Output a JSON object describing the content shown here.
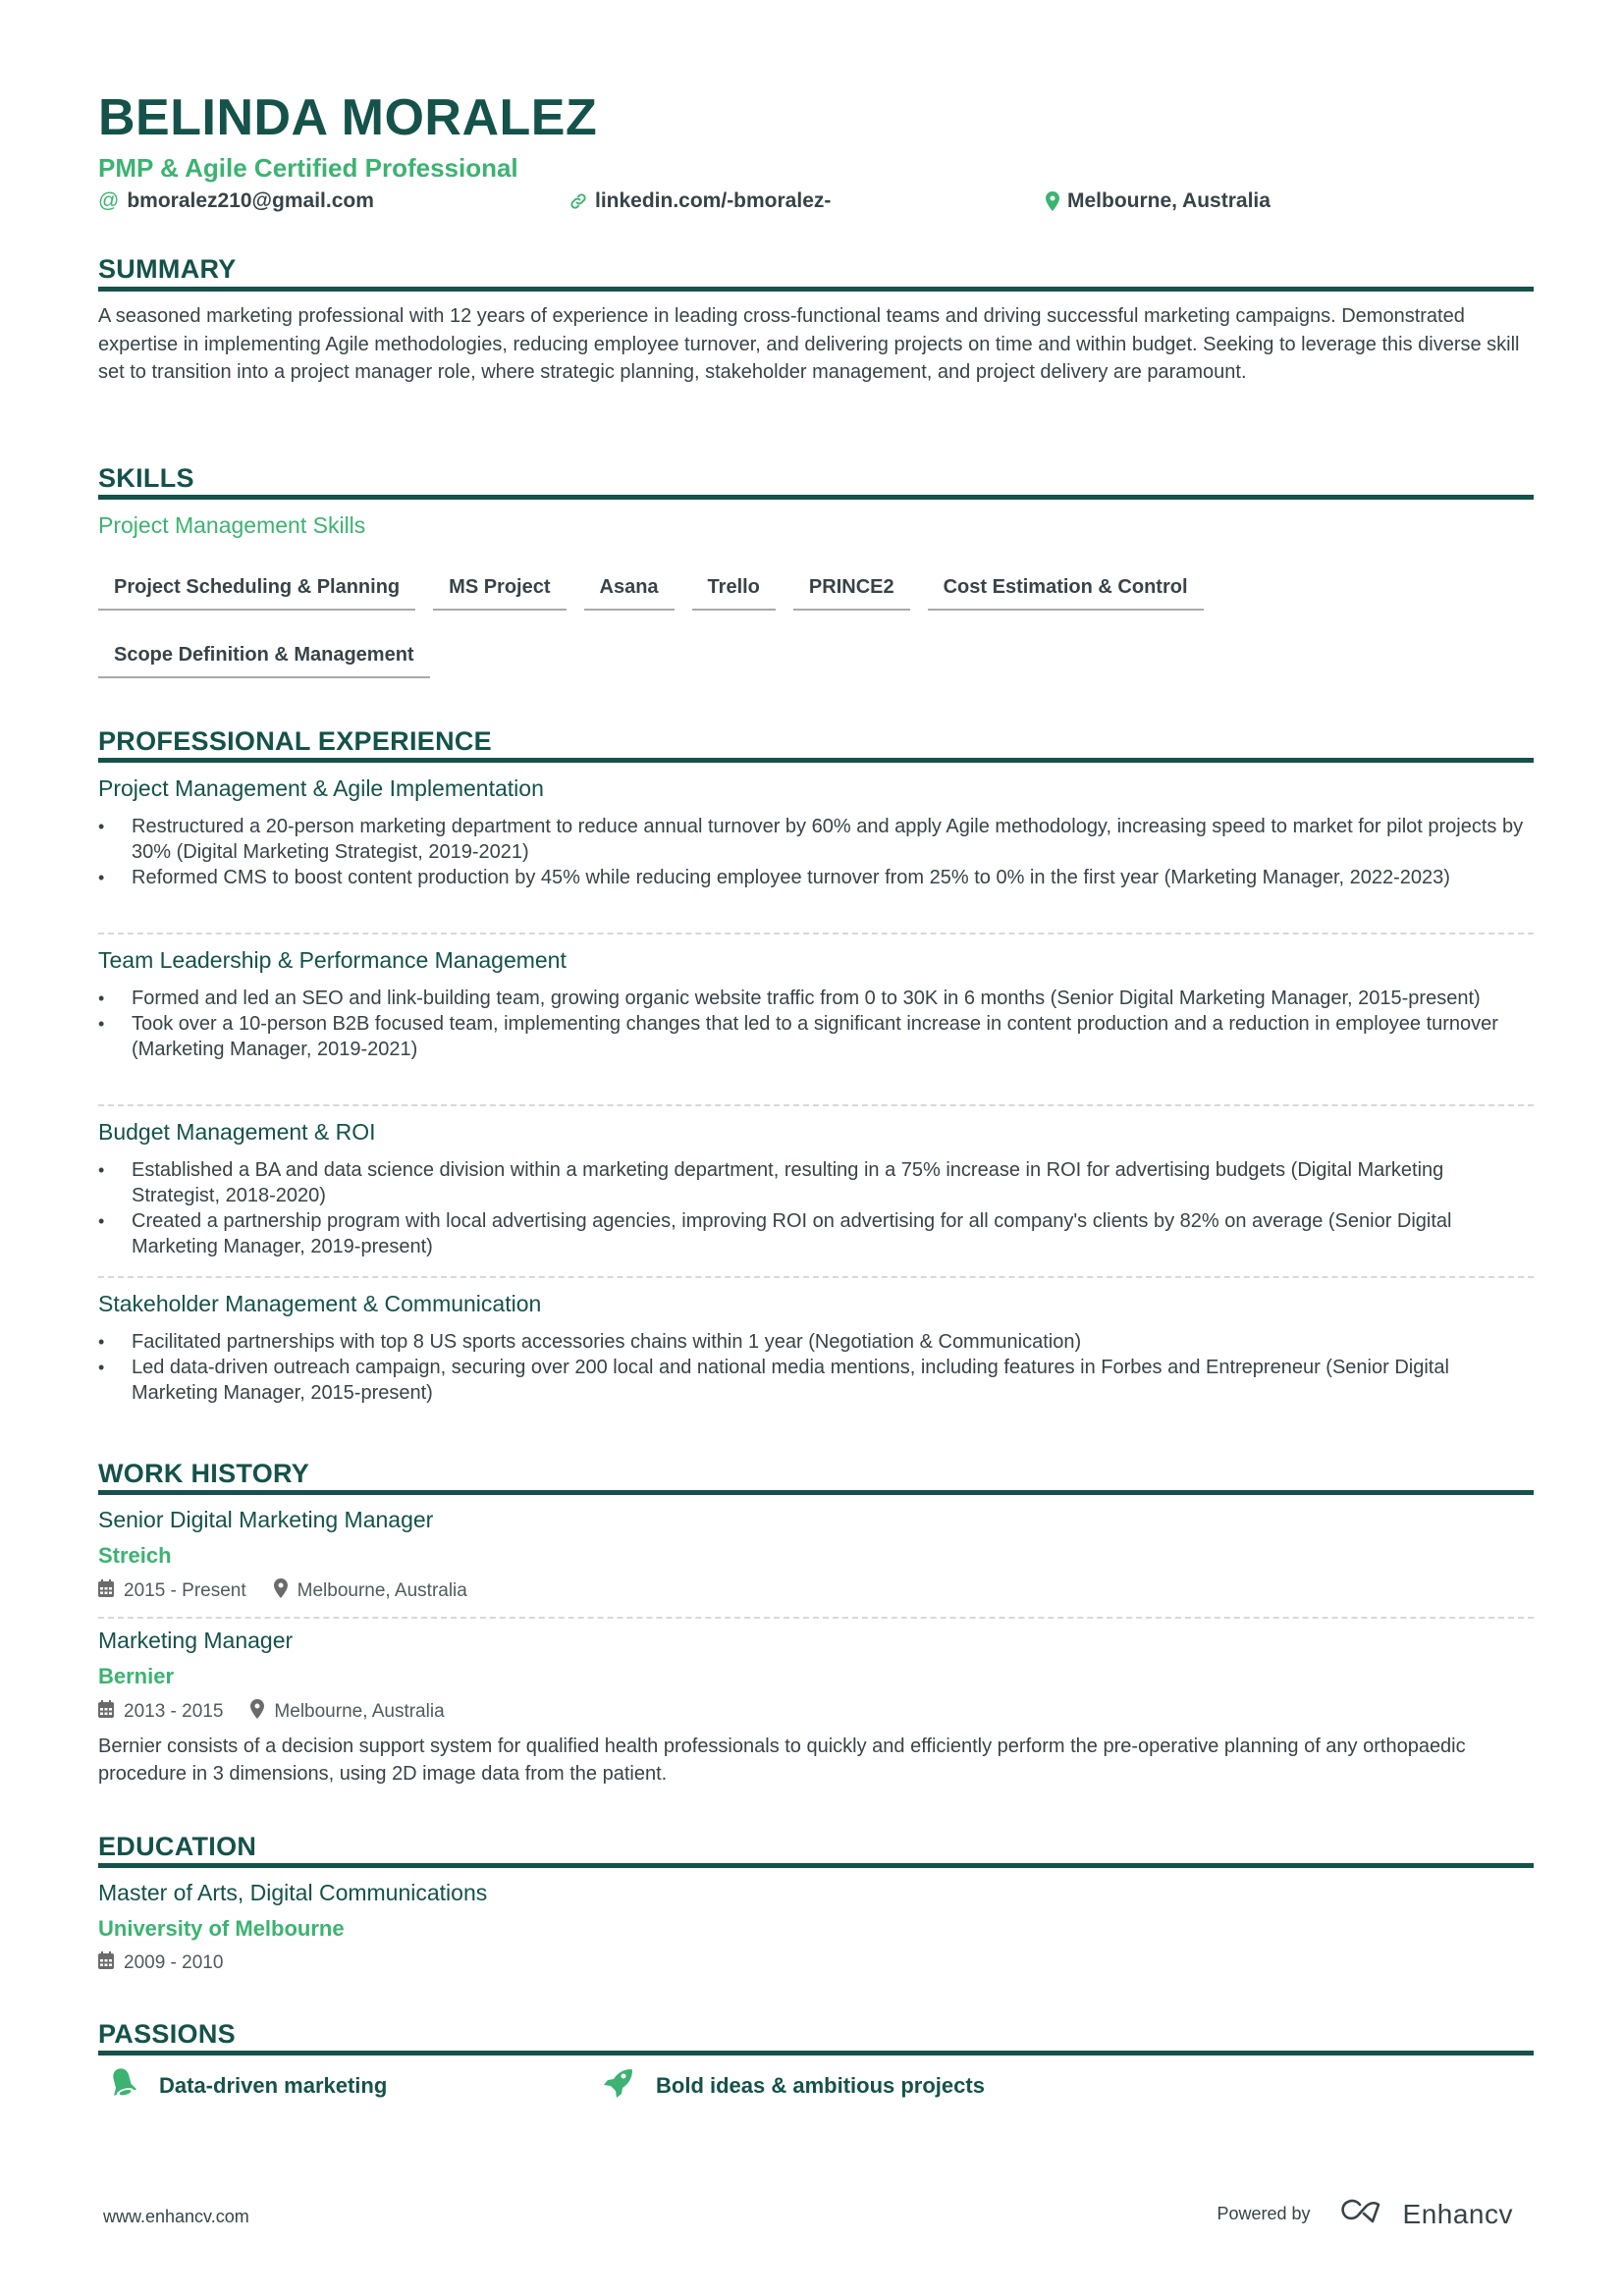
{
  "header": {
    "name": "BELINDA MORALEZ",
    "headline": "PMP & Agile Certified Professional",
    "contacts": {
      "email": "bmoralez210@gmail.com",
      "linkedin": "linkedin.com/-bmoralez-",
      "location": "Melbourne, Australia"
    },
    "icons": [
      "at-icon",
      "link-icon",
      "map-pin-icon"
    ]
  },
  "summary": {
    "title": "SUMMARY",
    "text": "A seasoned marketing professional with 12 years of experience in leading cross-functional teams and driving successful marketing campaigns. Demonstrated expertise in implementing Agile methodologies, reducing employee turnover, and delivering projects on time and within budget. Seeking to leverage this diverse skill set to transition into a project manager role, where strategic planning, stakeholder management, and project delivery are paramount."
  },
  "skills": {
    "title": "SKILLS",
    "group": "Project Management Skills",
    "items": [
      "Project Scheduling & Planning",
      "MS Project",
      "Asana",
      "Trello",
      "PRINCE2",
      "Cost Estimation & Control",
      "Scope Definition & Management"
    ]
  },
  "experience": {
    "title": "PROFESSIONAL EXPERIENCE",
    "groups": [
      {
        "title": "Project Management & Agile Implementation",
        "bullets": [
          "Restructured a 20-person marketing department to reduce annual turnover by 60% and apply Agile methodology, increasing speed to market for pilot projects by 30% (Digital Marketing Strategist, 2019-2021)",
          "Reformed CMS to boost content production by 45% while reducing employee turnover from 25% to 0% in the first year (Marketing Manager, 2022-2023)"
        ]
      },
      {
        "title": "Team Leadership & Performance Management",
        "bullets": [
          "Formed and led an SEO and link-building team, growing organic website traffic from 0 to 30K in 6 months (Senior Digital Marketing Manager, 2015-present)",
          "Took over a 10-person B2B focused team, implementing changes that led to a significant increase in content production and a reduction in employee turnover (Marketing Manager, 2019-2021)"
        ]
      },
      {
        "title": "Budget Management & ROI",
        "bullets": [
          "Established a BA and data science division within a marketing department, resulting in a 75% increase in ROI for advertising budgets (Digital Marketing Strategist, 2018-2020)",
          "Created a partnership program with local advertising agencies, improving ROI on advertising for all company's clients by 82% on average (Senior Digital Marketing Manager, 2019-present)"
        ]
      },
      {
        "title": "Stakeholder Management & Communication",
        "bullets": [
          "Facilitated partnerships with top 8 US sports accessories chains within 1 year (Negotiation & Communication)",
          "Led data-driven outreach campaign, securing over 200 local and national media mentions, including features in Forbes and Entrepreneur (Senior Digital Marketing Manager, 2015-present)"
        ]
      }
    ]
  },
  "work_history": {
    "title": "WORK HISTORY",
    "jobs": [
      {
        "title": "Senior Digital Marketing Manager",
        "company": "Streich",
        "dates": "2015 - Present",
        "location": "Melbourne, Australia",
        "description": ""
      },
      {
        "title": "Marketing Manager",
        "company": "Bernier",
        "dates": "2013 - 2015",
        "location": "Melbourne, Australia",
        "description": "Bernier consists of a decision support system for qualified health professionals to quickly and efficiently perform the pre-operative planning of any orthopaedic procedure in 3 dimensions, using 2D image data from the patient."
      }
    ]
  },
  "education": {
    "title": "EDUCATION",
    "degree": "Master of Arts, Digital Communications",
    "school": "University of Melbourne",
    "dates": "2009 - 2010"
  },
  "passions": {
    "title": "PASSIONS",
    "items": [
      {
        "label": "Data-driven marketing",
        "icon": "bell-icon"
      },
      {
        "label": "Bold ideas & ambitious projects",
        "icon": "rocket-icon"
      }
    ]
  },
  "footer": {
    "website": "www.enhancv.com",
    "powered_by": "Powered by",
    "brand": "Enhancv"
  },
  "colors": {
    "primary": "#14524a",
    "accent": "#3cb371",
    "text": "#384347"
  }
}
